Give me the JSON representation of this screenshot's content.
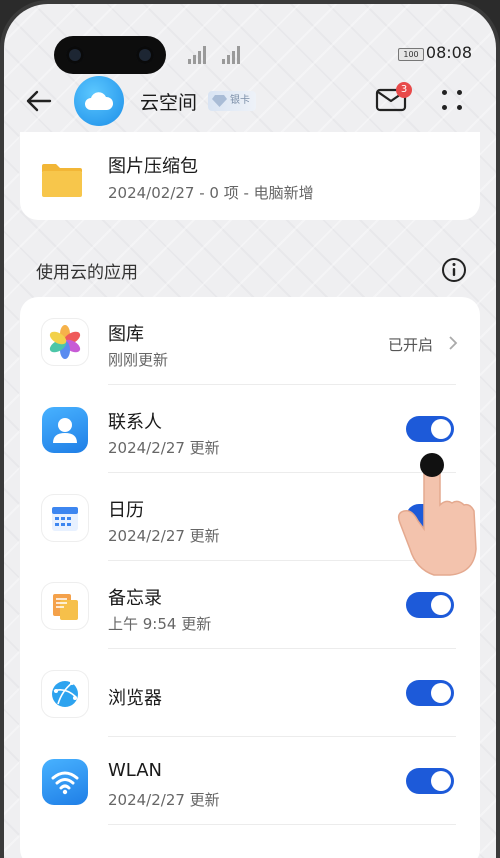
{
  "status_bar": {
    "battery": "100",
    "time": "08:08"
  },
  "header": {
    "title": "云空间",
    "level_badge": "银卡",
    "mail_count": "3"
  },
  "folder": {
    "title": "图片压缩包",
    "subtitle": "2024/02/27 - 0 项 - 电脑新增"
  },
  "section": {
    "title": "使用云的应用"
  },
  "apps": [
    {
      "name": "图库",
      "sub": "刚刚更新",
      "status": "已开启",
      "icon": "gallery-icon"
    },
    {
      "name": "联系人",
      "sub": "2024/2/27 更新",
      "toggle": true,
      "icon": "contacts-icon"
    },
    {
      "name": "日历",
      "sub": "2024/2/27 更新",
      "toggle": true,
      "icon": "calendar-icon"
    },
    {
      "name": "备忘录",
      "sub": "上午 9:54 更新",
      "toggle": true,
      "icon": "notepad-icon"
    },
    {
      "name": "浏览器",
      "sub": "",
      "toggle": true,
      "icon": "browser-icon"
    },
    {
      "name": "WLAN",
      "sub": "2024/2/27 更新",
      "toggle": true,
      "icon": "wlan-icon"
    }
  ],
  "colors": {
    "accent": "#1d5ad9",
    "badge": "#e84a4a",
    "background": "#efeff1"
  }
}
